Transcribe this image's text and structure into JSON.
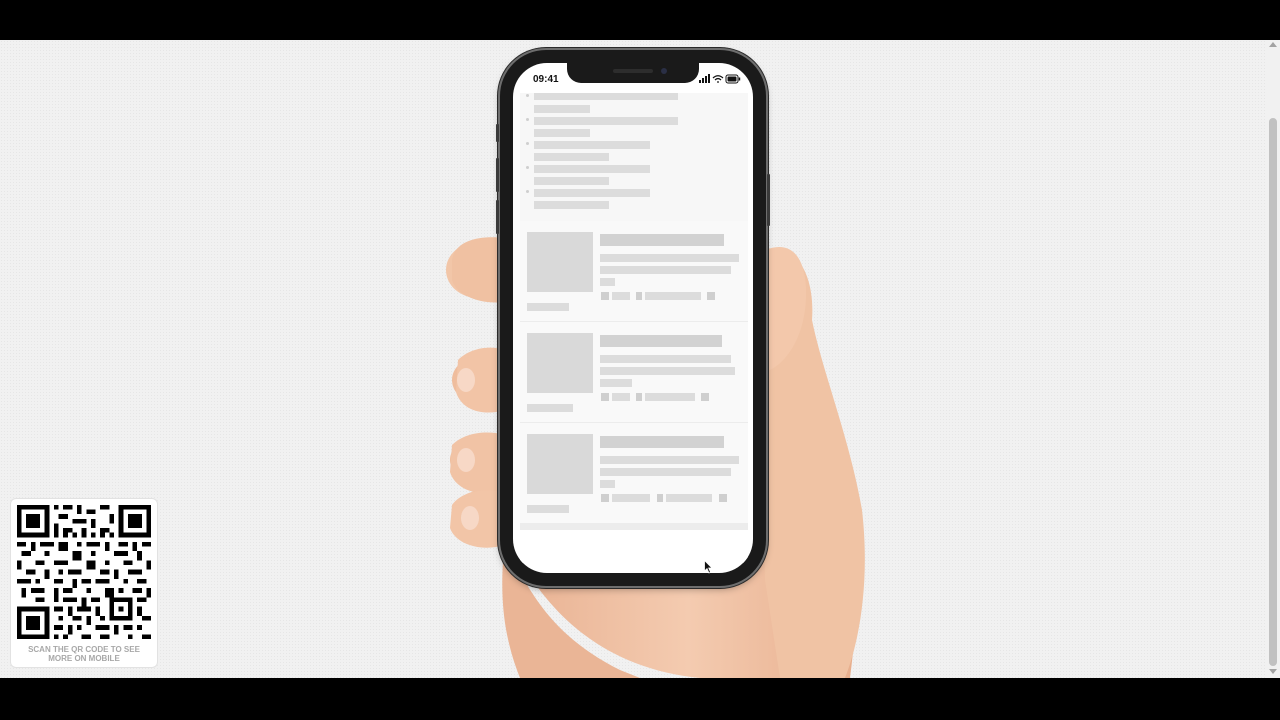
{
  "phone": {
    "status_time": "09:41"
  },
  "qr": {
    "caption": "SCAN THE QR CODE TO SEE MORE ON MOBILE"
  },
  "colors": {
    "background": "#f1f1f1",
    "skeleton": "#dcdcdc",
    "skin": "#f0c3a4",
    "caption": "#a8a8a8"
  },
  "icons": [
    "person-icon",
    "tag-icon",
    "copy-icon",
    "signal-icon",
    "wifi-icon",
    "battery-icon",
    "mouse-cursor-icon",
    "qr-code"
  ]
}
